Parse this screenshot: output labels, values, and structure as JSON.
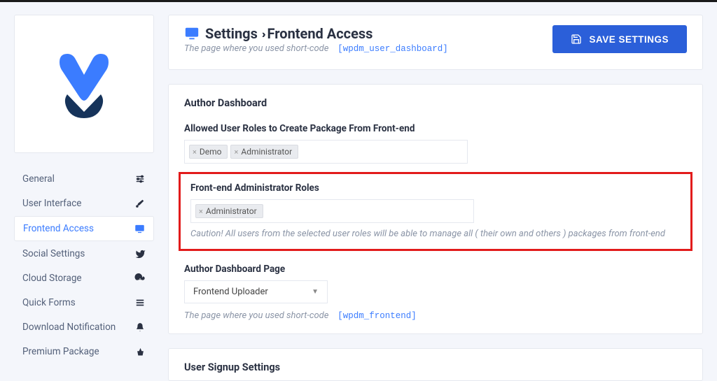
{
  "sidebar": {
    "items": [
      {
        "label": "General",
        "icon": "sliders-icon"
      },
      {
        "label": "User Interface",
        "icon": "paint-icon"
      },
      {
        "label": "Frontend Access",
        "icon": "monitor-icon"
      },
      {
        "label": "Social Settings",
        "icon": "twitter-icon"
      },
      {
        "label": "Cloud Storage",
        "icon": "cloud-icon"
      },
      {
        "label": "Quick Forms",
        "icon": "list-icon"
      },
      {
        "label": "Download Notification",
        "icon": "bell-icon"
      },
      {
        "label": "Premium Package",
        "icon": "basket-icon"
      }
    ]
  },
  "header": {
    "title_a": "Settings",
    "title_b": "Frontend Access",
    "hint_prefix": "The page where you used short-code",
    "hint_code": "[wpdm_user_dashboard]",
    "save_label": "SAVE SETTINGS"
  },
  "author_dashboard": {
    "title": "Author Dashboard",
    "allowed_roles_label": "Allowed User Roles to Create Package From Front-end",
    "allowed_roles": [
      "Demo",
      "Administrator"
    ],
    "admin_roles_label": "Front-end Administrator Roles",
    "admin_roles": [
      "Administrator"
    ],
    "caution": "Caution! All users from the selected user roles will be able to manage all ( their own and others ) packages from front-end",
    "page_label": "Author Dashboard Page",
    "page_selected": "Frontend Uploader",
    "page_hint_prefix": "The page where you used short-code",
    "page_hint_code": "[wpdm_frontend]"
  },
  "signup": {
    "title": "User Signup Settings"
  }
}
